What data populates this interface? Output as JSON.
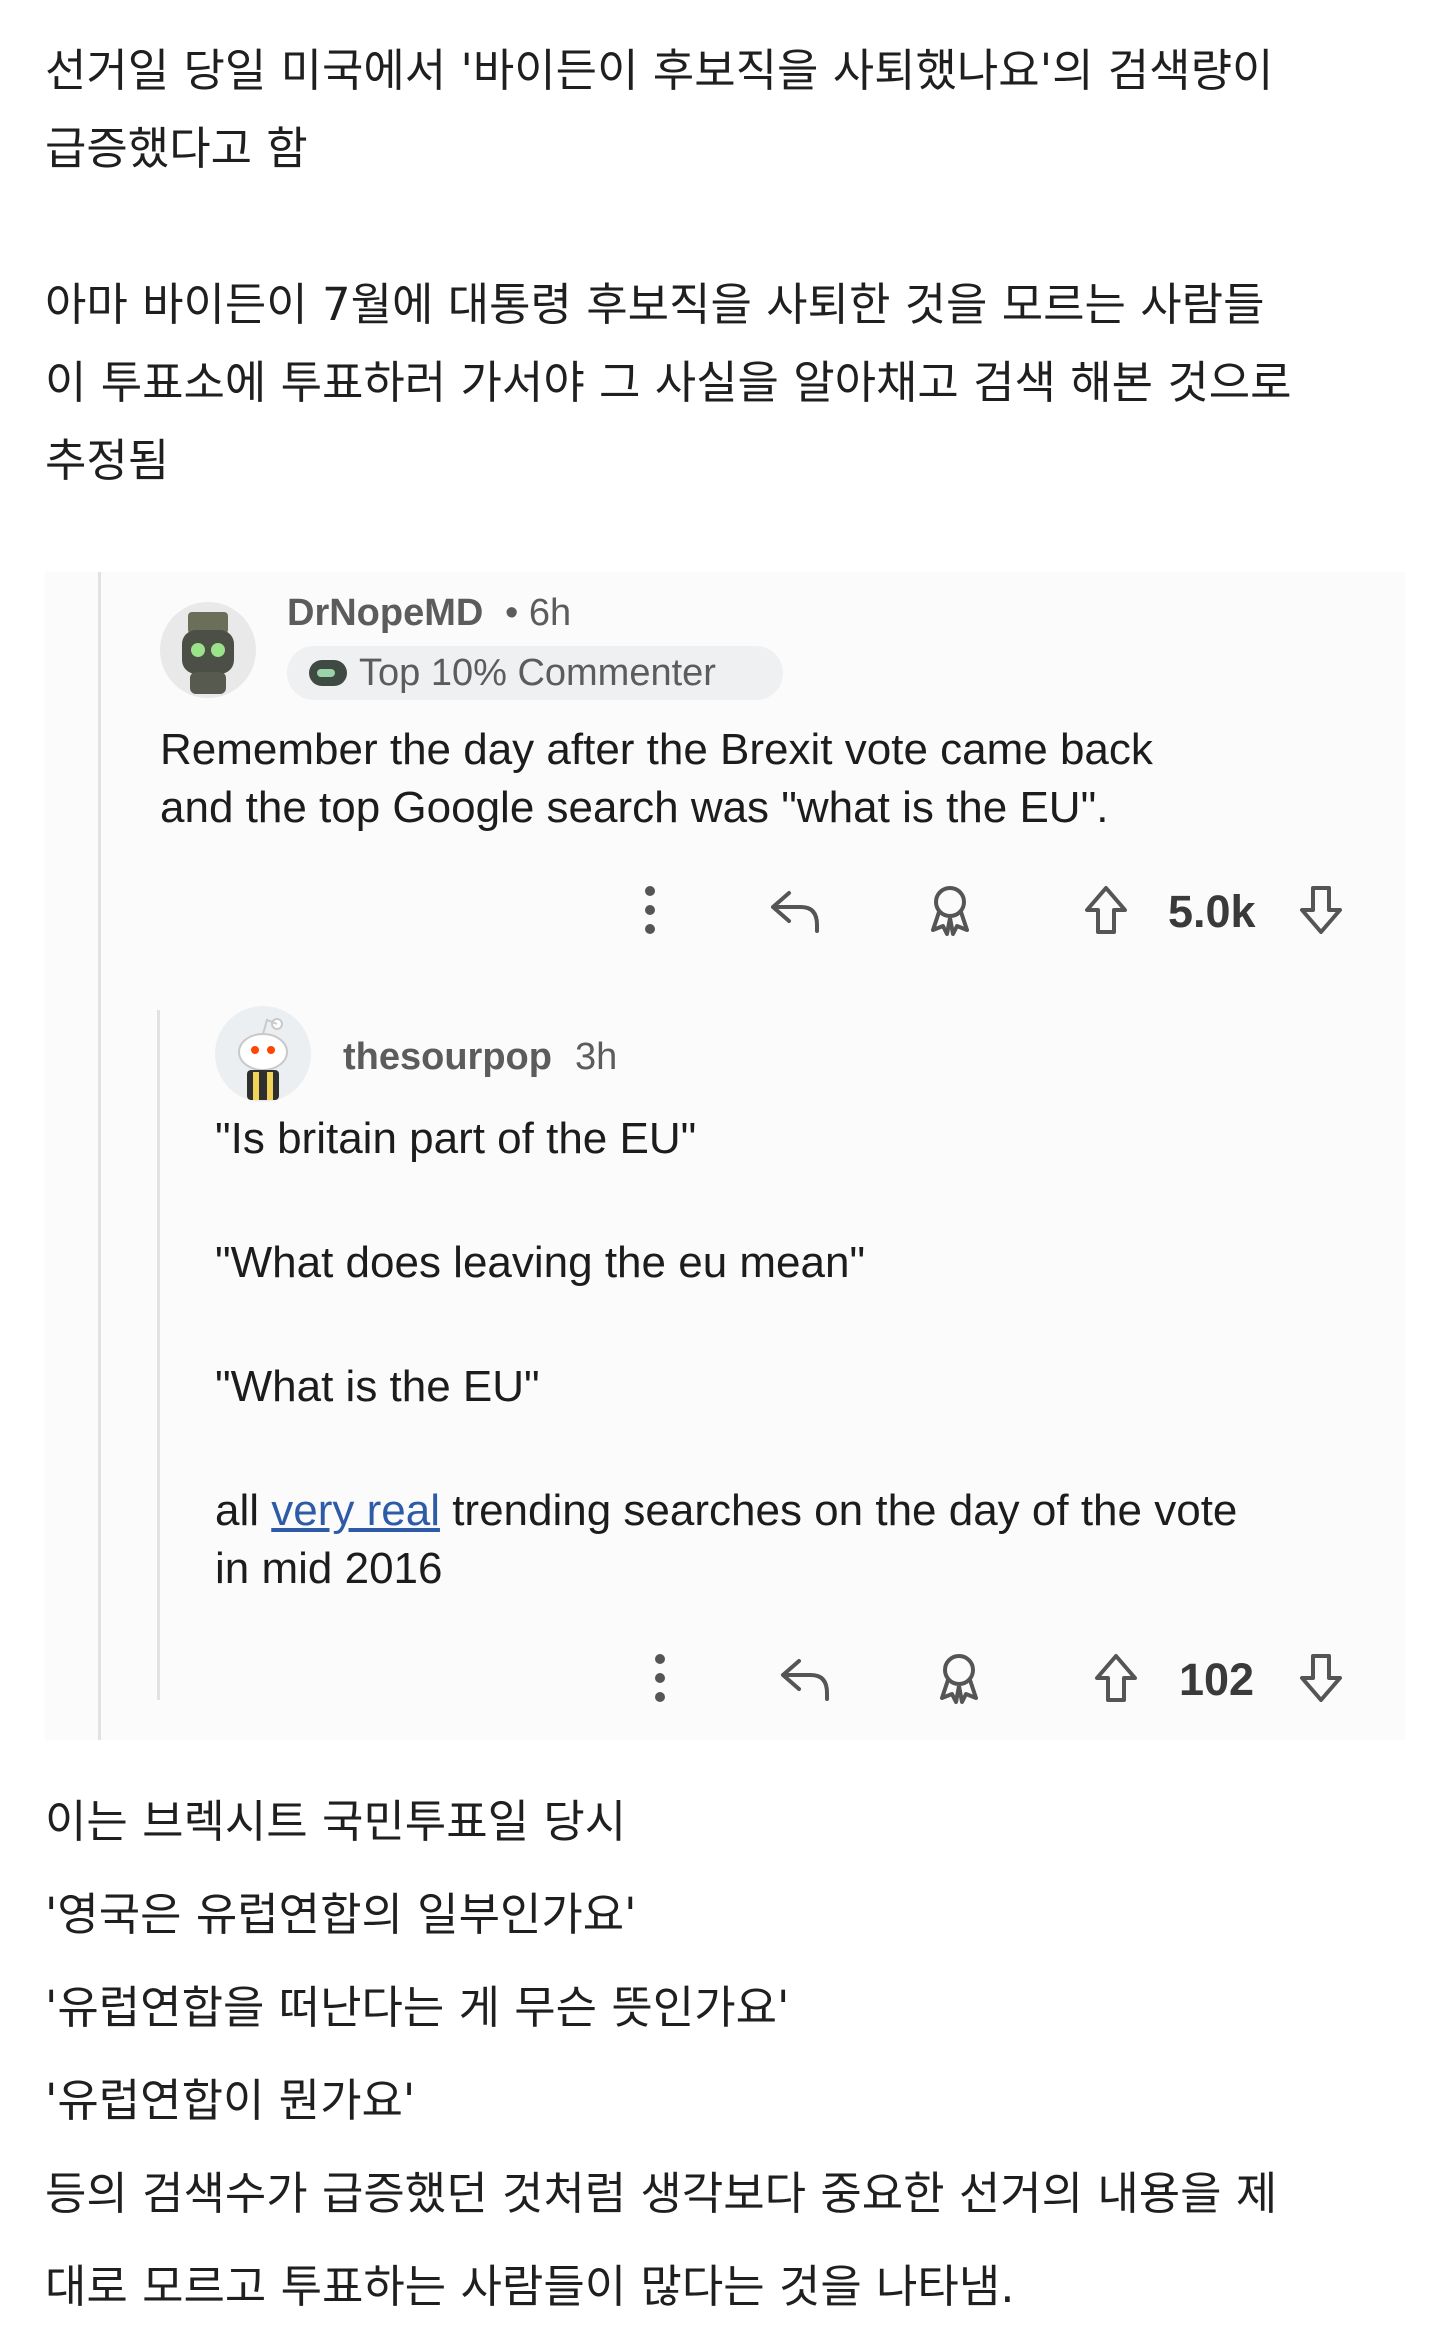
{
  "intro": {
    "lines": [
      "선거일 당일 미국에서 '바이든이 후보직을 사퇴했나요'의 검색량이",
      "급증했다고 함",
      "아마 바이든이 7월에 대통령 후보직을 사퇴한 것을 모르는 사람들",
      "이 투표소에 투표하러 가서야 그 사실을 알아채고 검색 해본 것으로",
      "추정됨"
    ]
  },
  "comment1": {
    "username": "DrNopeMD",
    "time": "• 6h",
    "badge": "Top 10% Commenter",
    "text_lines": [
      "Remember the day after the Brexit vote came back",
      "and the top Google search was \"what is the EU\"."
    ],
    "votes": "5.0k",
    "icons": [
      "more-icon",
      "reply-icon",
      "award-icon",
      "upvote-icon",
      "downvote-icon"
    ]
  },
  "comment2": {
    "username": "thesourpop",
    "time": "3h",
    "quotes": [
      "\"Is britain part of the EU\"",
      "\"What does leaving the eu mean\"",
      "\"What is the EU\""
    ],
    "final_pre": "all ",
    "final_link": "very real",
    "final_post": " trending searches on the day of the vote",
    "final_line2": "in mid 2016",
    "votes": "102",
    "icons": [
      "more-icon",
      "reply-icon",
      "award-icon",
      "upvote-icon",
      "downvote-icon"
    ]
  },
  "outro": {
    "lines": [
      "이는 브렉시트 국민투표일 당시",
      "'영국은 유럽연합의 일부인가요'",
      "'유럽연합을 떠난다는 게 무슨 뜻인가요'",
      "'유럽연합이 뭔가요'",
      "등의 검색수가 급증했던 것처럼 생각보다 중요한 선거의 내용을 제",
      "대로 모르고 투표하는 사람들이 많다는 것을 나타냄."
    ]
  },
  "colors": {
    "link": "#2d5ba8",
    "meta_text": "#5c5c5c",
    "thread_line": "#e2e2e2",
    "badge_bg": "#eef0f2"
  }
}
